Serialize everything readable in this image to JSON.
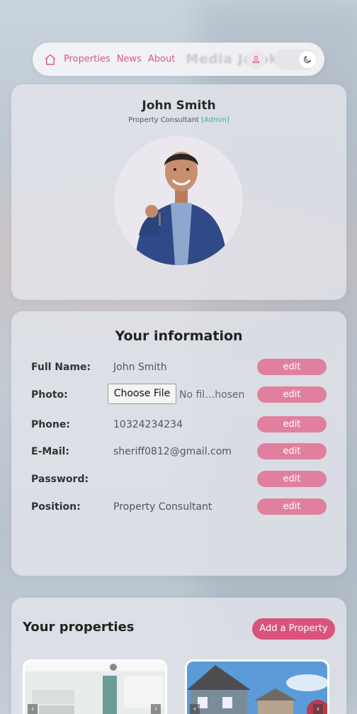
{
  "nav": {
    "links": [
      "Properties",
      "News",
      "About"
    ],
    "ghost_text": "Media Jatok"
  },
  "profile": {
    "name": "John Smith",
    "role": "Property Consultant",
    "badge": "[Admin]"
  },
  "info": {
    "title": "Your information",
    "edit_label": "edit",
    "rows": [
      {
        "label": "Full Name:",
        "value": "John Smith"
      },
      {
        "label": "Photo:",
        "value": ""
      },
      {
        "label": "Phone:",
        "value": "10324234234"
      },
      {
        "label": "E-Mail:",
        "value": "sheriff0812@gmail.com"
      },
      {
        "label": "Password:",
        "value": ""
      },
      {
        "label": "Position:",
        "value": "Property Consultant"
      }
    ],
    "file_button": "Choose File",
    "file_status": "No fil…hosen"
  },
  "properties": {
    "title": "Your properties",
    "add_button": "Add a Property"
  },
  "colors": {
    "accent": "#d9547c",
    "edit": "#e0809e",
    "admin": "#3fb39a"
  }
}
